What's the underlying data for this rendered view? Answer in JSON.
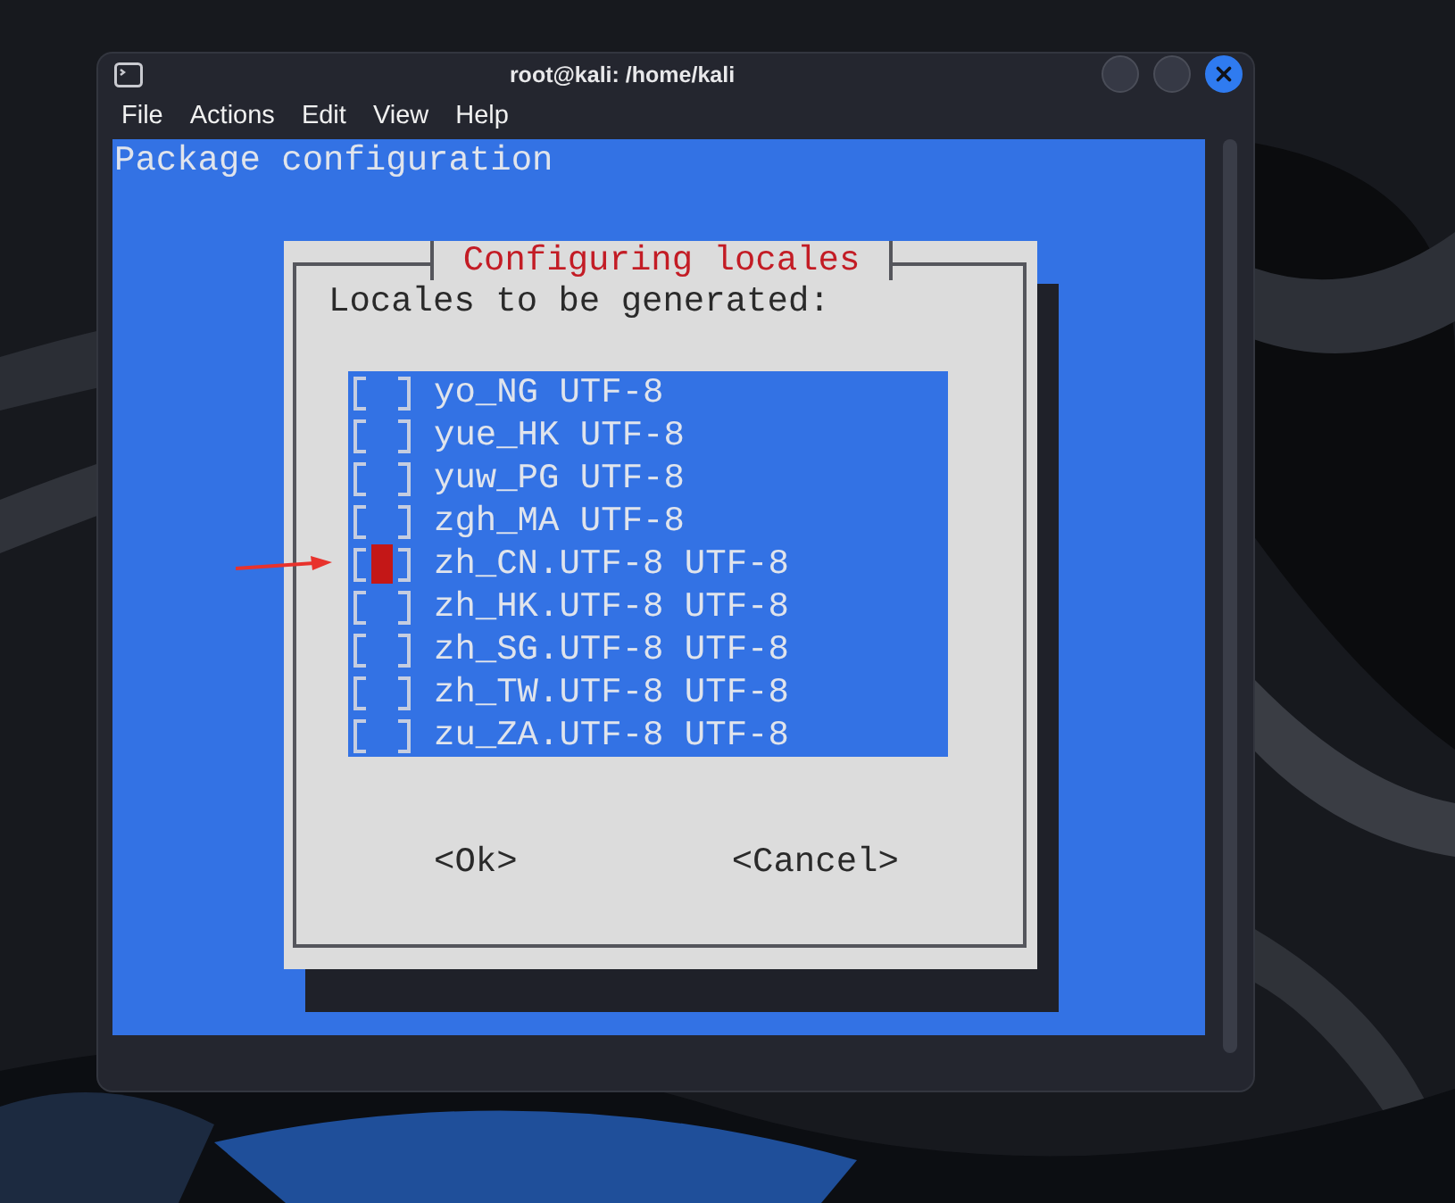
{
  "window": {
    "title": "root@kali: /home/kali"
  },
  "menu": [
    "File",
    "Actions",
    "Edit",
    "View",
    "Help"
  ],
  "terminal": {
    "heading": "Package configuration",
    "dialog": {
      "title": "Configuring locales",
      "prompt": "Locales to be generated:",
      "items": [
        {
          "label": "yo_NG UTF-8",
          "checked": false,
          "selected": false
        },
        {
          "label": "yue_HK UTF-8",
          "checked": false,
          "selected": false
        },
        {
          "label": "yuw_PG UTF-8",
          "checked": false,
          "selected": false
        },
        {
          "label": "zgh_MA UTF-8",
          "checked": false,
          "selected": false
        },
        {
          "label": "zh_CN.UTF-8 UTF-8",
          "checked": false,
          "selected": true
        },
        {
          "label": "zh_HK.UTF-8 UTF-8",
          "checked": false,
          "selected": false
        },
        {
          "label": "zh_SG.UTF-8 UTF-8",
          "checked": false,
          "selected": false
        },
        {
          "label": "zh_TW.UTF-8 UTF-8",
          "checked": false,
          "selected": false
        },
        {
          "label": "zu_ZA.UTF-8 UTF-8",
          "checked": false,
          "selected": false
        }
      ],
      "buttons": [
        "<Ok>",
        "<Cancel>"
      ]
    }
  }
}
